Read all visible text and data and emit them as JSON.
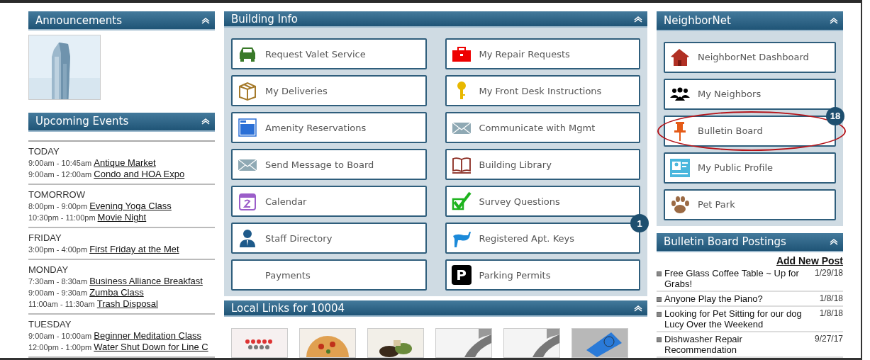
{
  "announcements": {
    "title": "Announcements"
  },
  "upcoming_events": {
    "title": "Upcoming Events",
    "days": [
      {
        "day": "TODAY",
        "events": [
          {
            "time": "9:00am - 10:45am",
            "title": "Antique Market"
          },
          {
            "time": "9:00am - 12:00am",
            "title": "Condo and HOA Expo"
          }
        ]
      },
      {
        "day": "TOMORROW",
        "events": [
          {
            "time": "8:00pm - 9:00pm",
            "title": "Evening Yoga Class"
          },
          {
            "time": "10:30pm - 11:00pm",
            "title": "Movie Night"
          }
        ]
      },
      {
        "day": "FRIDAY",
        "events": [
          {
            "time": "3:00pm - 4:00pm",
            "title": "First Friday at the Met"
          }
        ]
      },
      {
        "day": "MONDAY",
        "events": [
          {
            "time": "7:30am - 8:30am",
            "title": "Business Alliance Breakfast"
          },
          {
            "time": "9:00am - 9:30am",
            "title": "Zumba Class"
          },
          {
            "time": "11:00am - 11:30am",
            "title": "Trash Disposal"
          }
        ]
      },
      {
        "day": "TUESDAY",
        "events": [
          {
            "time": "9:00am - 10:00am",
            "title": "Beginner Meditation Class"
          },
          {
            "time": "12:00pm - 1:00pm",
            "title": "Water Shut Down for Line C"
          }
        ]
      }
    ]
  },
  "building_info": {
    "title": "Building Info",
    "tiles": [
      {
        "label": "Request Valet Service"
      },
      {
        "label": "My Repair Requests"
      },
      {
        "label": "My Deliveries"
      },
      {
        "label": "My Front Desk Instructions"
      },
      {
        "label": "Amenity Reservations"
      },
      {
        "label": "Communicate with Mgmt"
      },
      {
        "label": "Send Message to Board"
      },
      {
        "label": "Building Library"
      },
      {
        "label": "Calendar"
      },
      {
        "label": "Survey Questions"
      },
      {
        "label": "Staff Directory"
      },
      {
        "label": "Registered Apt. Keys",
        "badge": "1"
      },
      {
        "label": "Payments"
      },
      {
        "label": "Parking Permits",
        "icon_letter": "P"
      }
    ]
  },
  "local_links": {
    "title": "Local Links for 10004"
  },
  "neighbornet": {
    "title": "NeighborNet",
    "tiles": [
      {
        "label": "NeighborNet Dashboard",
        "highlighted": false
      },
      {
        "label": "My Neighbors",
        "highlighted": false
      },
      {
        "label": "Bulletin Board",
        "badge": "18",
        "highlighted": true
      },
      {
        "label": "My Public Profile",
        "highlighted": false
      },
      {
        "label": "Pet Park",
        "highlighted": false
      }
    ]
  },
  "bulletin_postings": {
    "title": "Bulletin Board Postings",
    "add_link": "Add New Post",
    "posts": [
      {
        "title": "Free Glass Coffee Table ~ Up for Grabs!",
        "date": "1/29/18"
      },
      {
        "title": "Anyone Play the Piano?",
        "date": "1/8/18"
      },
      {
        "title": "Looking for Pet Sitting for our dog Lucy Over the Weekend",
        "date": "1/8/18"
      },
      {
        "title": "Dishwasher Repair Recommendation",
        "date": "9/27/17"
      }
    ]
  }
}
